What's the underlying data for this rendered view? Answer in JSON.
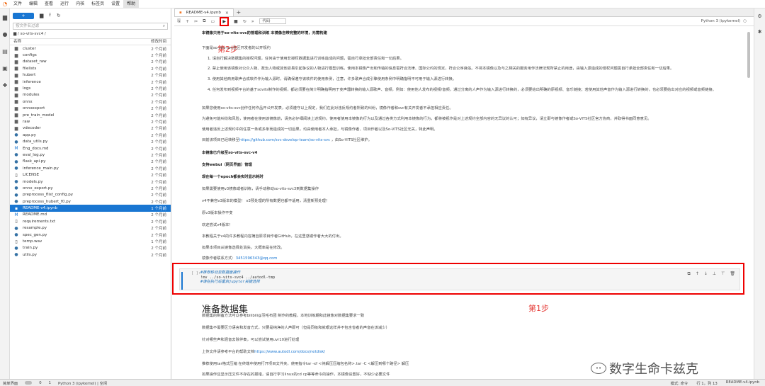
{
  "menu": [
    "文件",
    "编辑",
    "查看",
    "运行",
    "内核",
    "标签页",
    "设置",
    "帮助"
  ],
  "active_menu_index": 7,
  "activity_icons": [
    "folder-icon",
    "running-icon",
    "commands-icon",
    "tabs-icon",
    "extensions-icon"
  ],
  "filebrowser": {
    "new_label": "+",
    "filter_placeholder": "按文件名过滤",
    "path": "/ so-vits-svc4 /",
    "col_name": "名称",
    "col_modified": "修改时间",
    "files": [
      {
        "name": "cluster",
        "type": "folder",
        "modified": "2 个月前"
      },
      {
        "name": "configs",
        "type": "folder",
        "modified": "2 个月前"
      },
      {
        "name": "dataset_raw",
        "type": "folder",
        "modified": "2 个月前"
      },
      {
        "name": "filelists",
        "type": "folder",
        "modified": "2 个月前"
      },
      {
        "name": "hubert",
        "type": "folder",
        "modified": "2 个月前"
      },
      {
        "name": "inference",
        "type": "folder",
        "modified": "2 个月前"
      },
      {
        "name": "logs",
        "type": "folder",
        "modified": "2 个月前"
      },
      {
        "name": "modules",
        "type": "folder",
        "modified": "2 个月前"
      },
      {
        "name": "onnx",
        "type": "folder",
        "modified": "2 个月前"
      },
      {
        "name": "onnxexport",
        "type": "folder",
        "modified": "2 个月前"
      },
      {
        "name": "pre_train_model",
        "type": "folder",
        "modified": "2 个月前"
      },
      {
        "name": "raw",
        "type": "folder",
        "modified": "2 个月前"
      },
      {
        "name": "vdecoder",
        "type": "folder",
        "modified": "2 个月前"
      },
      {
        "name": "app.py",
        "type": "py",
        "modified": "2 个月前"
      },
      {
        "name": "data_utils.py",
        "type": "py",
        "modified": "2 个月前"
      },
      {
        "name": "Eng_docs.md",
        "type": "md",
        "modified": "2 个月前"
      },
      {
        "name": "eval_log.py",
        "type": "py",
        "modified": "2 个月前"
      },
      {
        "name": "flask_api.py",
        "type": "py",
        "modified": "2 个月前"
      },
      {
        "name": "inference_main.py",
        "type": "py",
        "modified": "2 个月前"
      },
      {
        "name": "LICENSE",
        "type": "file",
        "modified": "2 个月前"
      },
      {
        "name": "models.py",
        "type": "py",
        "modified": "2 个月前"
      },
      {
        "name": "onnx_export.py",
        "type": "py",
        "modified": "2 个月前"
      },
      {
        "name": "preprocess_flist_config.py",
        "type": "py",
        "modified": "2 个月前"
      },
      {
        "name": "preprocess_hubert_f0.py",
        "type": "py",
        "modified": "2 个月前"
      },
      {
        "name": "README-v4.ipynb",
        "type": "nb",
        "modified": "1 个月前",
        "selected": true
      },
      {
        "name": "README.md",
        "type": "md",
        "modified": "2 个月前"
      },
      {
        "name": "requirements.txt",
        "type": "file",
        "modified": "2 个月前"
      },
      {
        "name": "resample.py",
        "type": "py",
        "modified": "2 个月前"
      },
      {
        "name": "spec_gen.py",
        "type": "py",
        "modified": "2 个月前"
      },
      {
        "name": "temp.wav",
        "type": "file",
        "modified": "1 个月前"
      },
      {
        "name": "train.py",
        "type": "py",
        "modified": "2 个月前"
      },
      {
        "name": "utils.py",
        "type": "py",
        "modified": "2 个月前"
      }
    ]
  },
  "tab": {
    "title": "README-v4.ipynb"
  },
  "toolbar": {
    "cell_type": "代码",
    "kernel": "Python 3 (ipykernel)"
  },
  "annotations": {
    "step2": "第2步",
    "step1": "第1步"
  },
  "notebook": {
    "p1": "本镜像只用于so-vits-svc的管理和训练 本镜像自带完整的环境，无需构建",
    "p2": "下面是so-vits-svc社区开发者的公开规约",
    "li1": "1. 请自行解决数据集的授权问题，任何由于使用非授权数据集进行训练造成的问题，需自行承担全部责任和一切后果。",
    "li2": "2. 禁止使用该镜像对公众人物、政治人物或其他容易引起争议的人物进行模型训练。使用本镜像产出和传输的信息需符合法律、国际公约的规定，符合公序良俗。不将本镜像以及与之相关的服务用作法律法规所禁止的用途，由输入源造成的侵权问题需自行承担全部责任和一切后果。",
    "li3": "3. 使用其他商用歌声合成软件作为输入源时，请确保遵守该软件的使用条例，注意，许多歌声合成引擎使用条例中明确指明不可用于输入源进行转换。",
    "li4": "4. 任何发布到视频平台的基于sovits制作的视频，都必须要在简介明确指明用于变声器转换的输入源歌声、音频，例如：使用他人发布的视频/音频，通过分离的人声作为输入源进行转换的，必须要给出明确的原视频、音乐链接；若使用其他声音作为输入源进行转换的，也必须要给出对应的视频或音频链接。",
    "p3": "如果您使用so-vits-svc创作任何作品开公开发表，必须遵守以上规定，我们在此对违反规约者所致的纠纷，镜像作者和svc有关开发者不承担相应责任。",
    "p4": "为避免可能纠纷和风险，使用者在使用该镜像前，请务必仔细阅读上述规约。使用者使用本镜像的行为以及通过各类方式利用本镜像的行为，都将被视作是对上述规约全部内容的无异议的认可；如有异议，请立即与镜像作者或So-VITS社区官方协商，并取得书面同意意见。",
    "p5": "使用者违反上述规约中的任意一条或多条而造成的一切后果，均由使用者本人承担，与镜像作者、项目作者以及So-VITS社区无关，特此声明。",
    "p6_prefix": "目前该项目已经转移至",
    "p6_link": "https://github.com/svc-develop-team/so-vits-svc",
    "p6_suffix": " ，由So-VITS社区维护。",
    "p7": "本镜像已升级至so-vits-svc-v4",
    "p8": "支持webui（网页界面）管理",
    "p9": "现在每一个epoch都会实时显示耗时",
    "p10": "如果需要使用v3镜像或者训练，请手动移动so-vits-svc3到数据集操作",
    "p11": "v4不兼容v3版本的模型！ v3预处理的所有数据也都不适用，清重新预处理！",
    "p12": "原v3版本操作不变",
    "p13": "欢迎尝试v4版本！",
    "p14": "本教程关于v4的许多教程内容摘自原项目作者GitHub，在这里感谢作者大大的付出。",
    "p15": "如果本项目从镜像选择处消失，大概率是在修改。",
    "p16_prefix": "镜像作者联系方式：",
    "p16_link": "3451596343@qq.com",
    "cell_prompt": "[ ]:",
    "code1": "#推荐移动至数据盘操作",
    "code2": "!mv ../so-vits-svc4 ../autodl-tmp",
    "code3": "#请在执行后重启jupyter关键选择",
    "h_data": "准备数据集",
    "d1": "数据集的制备方法可以参考bilibili@羽毛布团 制作的教程，本地训练期和此镜像对数据集要求一致",
    "d2": "数据集不需要区分语言和发音方式，只要是纯净的人声即可（但是同级和就眼这样并不包含省者的声音在该减少）",
    "d3": "针对哪些声和混音去除伴奏，可以尝试使用uvr10进行处理",
    "d4_prefix": "上传文件请参考平台的帮助文档",
    "d4_link": "https://www.autodl.com/docs/netdisk/",
    "d5": "推荐使用tar格式压缩 在终端中使用打开项目文件夹，使用指令tar -xf <待解压压缩包名称>.tar -C <解压到哪个路径> 解压",
    "d6": "如果操作应显示压文件不存在的报错，请自行学习linux的cd cp等等命令的操作，本镜像设置好，不缺少必要文件",
    "d7": "推荐为符提搞的关键信息搜索一下看看是什么意思"
  },
  "watermark": {
    "text": "数字生命卡兹克"
  },
  "statusbar": {
    "simple": "简单界面",
    "count1": "0",
    "count2": "1",
    "kernel": "Python 3 (ipykernel) | 空闲",
    "mode": "模式: 命令",
    "pos": "行 1，列 13",
    "file": "README-v4.ipynb"
  }
}
